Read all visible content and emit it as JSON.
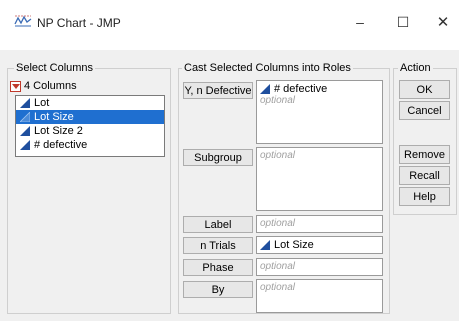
{
  "window": {
    "title": "NP Chart - JMP",
    "minimize": "–",
    "maximize": "☐",
    "close": "✕"
  },
  "select_columns": {
    "label": "Select Columns",
    "count_label": "4 Columns",
    "items": [
      {
        "label": "Lot",
        "selected": false
      },
      {
        "label": "Lot Size",
        "selected": true
      },
      {
        "label": "Lot Size 2",
        "selected": false
      },
      {
        "label": "# defective",
        "selected": false
      }
    ]
  },
  "cast": {
    "label": "Cast Selected Columns into Roles",
    "roles": [
      {
        "button": "Y, n Defective",
        "value": "# defective",
        "placeholder": "optional"
      },
      {
        "button": "Subgroup",
        "value": "",
        "placeholder": "optional"
      },
      {
        "button": "Label",
        "value": "",
        "placeholder": "optional"
      },
      {
        "button": "n Trials",
        "value": "Lot Size",
        "placeholder": ""
      },
      {
        "button": "Phase",
        "value": "",
        "placeholder": "optional"
      },
      {
        "button": "By",
        "value": "",
        "placeholder": "optional"
      }
    ]
  },
  "action": {
    "label": "Action",
    "ok": "OK",
    "cancel": "Cancel",
    "remove": "Remove",
    "recall": "Recall",
    "help": "Help"
  },
  "colors": {
    "selection": "#1f6fd0",
    "continuous_icon": "#1f4f9e",
    "dropdown_icon": "#c0392b"
  }
}
